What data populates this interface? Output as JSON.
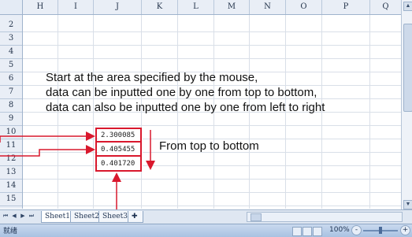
{
  "columns": [
    "H",
    "I",
    "J",
    "K",
    "L",
    "M",
    "N",
    "O",
    "P",
    "Q"
  ],
  "rows": [
    "2",
    "3",
    "4",
    "5",
    "6",
    "7",
    "8",
    "9",
    "10",
    "11",
    "12",
    "13",
    "14",
    "15"
  ],
  "annotation": {
    "lines": [
      "Start at the area specified by the mouse,",
      "data can be inputted one by one from top to bottom,",
      "data can also be inputted one by one from left to right"
    ],
    "direction_label": "From top to bottom"
  },
  "cells": [
    "2.300085",
    "0.405455",
    "0.401720"
  ],
  "sheet_tabs": [
    "Sheet1",
    "Sheet2",
    "Sheet3"
  ],
  "status": {
    "left_text": "就绪",
    "zoom": "100%",
    "zoom_minus": "-",
    "zoom_plus": "+"
  },
  "colors": {
    "annotation_red": "#d9182d",
    "header_bg": "#e9eef6"
  }
}
